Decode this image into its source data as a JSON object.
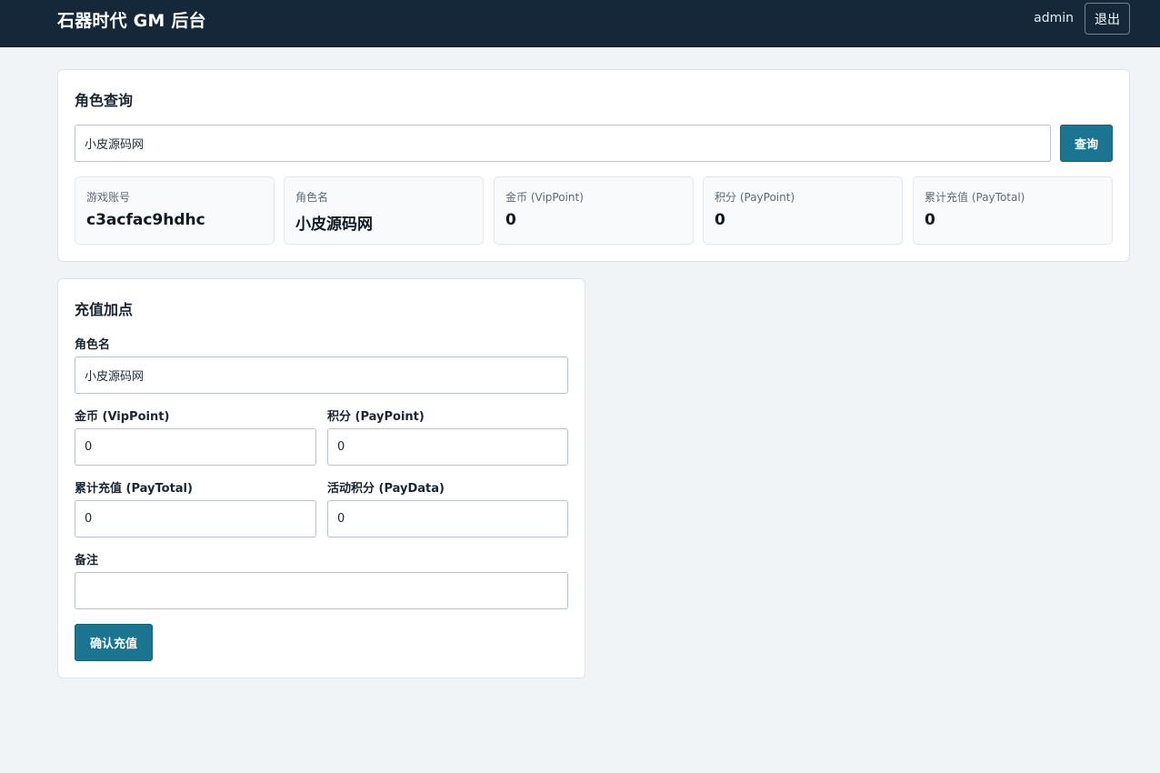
{
  "header": {
    "title": "石器时代 GM 后台",
    "username": "admin",
    "logout_label": "退出"
  },
  "query": {
    "title": "角色查询",
    "input_value": "小皮源码网",
    "button_label": "查询",
    "stats": [
      {
        "label": "游戏账号",
        "value": "c3acfac9hdhc"
      },
      {
        "label": "角色名",
        "value": "小皮源码网"
      },
      {
        "label": "金币 (VipPoint)",
        "value": "0"
      },
      {
        "label": "积分 (PayPoint)",
        "value": "0"
      },
      {
        "label": "累计充值 (PayTotal)",
        "value": "0"
      }
    ]
  },
  "recharge": {
    "title": "充值加点",
    "role_label": "角色名",
    "role_value": "小皮源码网",
    "vip_label": "金币 (VipPoint)",
    "vip_value": "0",
    "pay_label": "积分 (PayPoint)",
    "pay_value": "0",
    "total_label": "累计充值 (PayTotal)",
    "total_value": "0",
    "data_label": "活动积分 (PayData)",
    "data_value": "0",
    "note_label": "备注",
    "note_value": "",
    "submit_label": "确认充值"
  },
  "colors": {
    "header_bg": "#15283a",
    "primary": "#1b7591",
    "page_bg": "#f0f4f7"
  }
}
